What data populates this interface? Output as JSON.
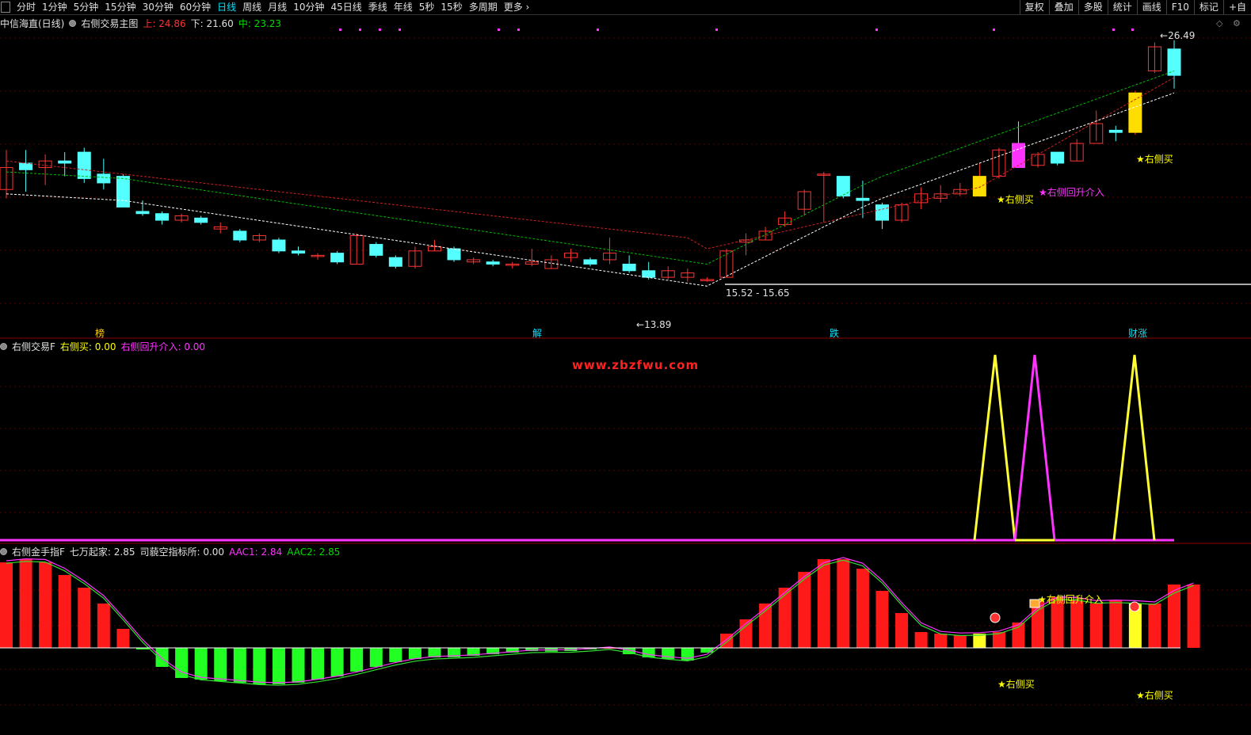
{
  "toolbar": {
    "periods": [
      "分时",
      "1分钟",
      "5分钟",
      "15分钟",
      "30分钟",
      "60分钟",
      "日线",
      "周线",
      "月线",
      "10分钟",
      "45日线",
      "季线",
      "年线",
      "5秒",
      "15秒",
      "多周期",
      "更多"
    ],
    "active": "日线",
    "right_buttons": [
      "复权",
      "叠加",
      "多股",
      "统计",
      "画线",
      "F10",
      "标记",
      "+自"
    ]
  },
  "main": {
    "title": "中信海直(日线)",
    "indicator": "右侧交易主图",
    "upper_label": "上: 24.86",
    "lower_label": "下: 21.60",
    "mid_label": "中: 23.23",
    "high_price": "26.49",
    "low_price": "13.89",
    "range_label": "15.52 - 15.65",
    "signal_buy": "★右侧买",
    "signal_reentry": "★右侧回升介入",
    "events": [
      "榜",
      "解",
      "跌",
      "财涨"
    ],
    "colors": {
      "up": "#ff3333",
      "down": "#54ffff",
      "upper": "#ff2020",
      "mid": "#00dd00",
      "lower": "#ffffff"
    }
  },
  "pane2": {
    "title": "右侧交易F",
    "buy_label": "右侧买: 0.00",
    "reentry_label": "右侧回升介入: 0.00",
    "watermark": "www.zbzfwu.com"
  },
  "pane3": {
    "title": "右侧金手指F",
    "qiwan": "七万起家: 2.85",
    "simiao": "司藐空指标所: 0.00",
    "aac1": "AAC1: 2.84",
    "aac2": "AAC2: 2.85",
    "signal_reentry": "★右侧回升介入",
    "signal_buy_1": "★右侧买",
    "signal_buy_2": "★右侧买"
  }
}
